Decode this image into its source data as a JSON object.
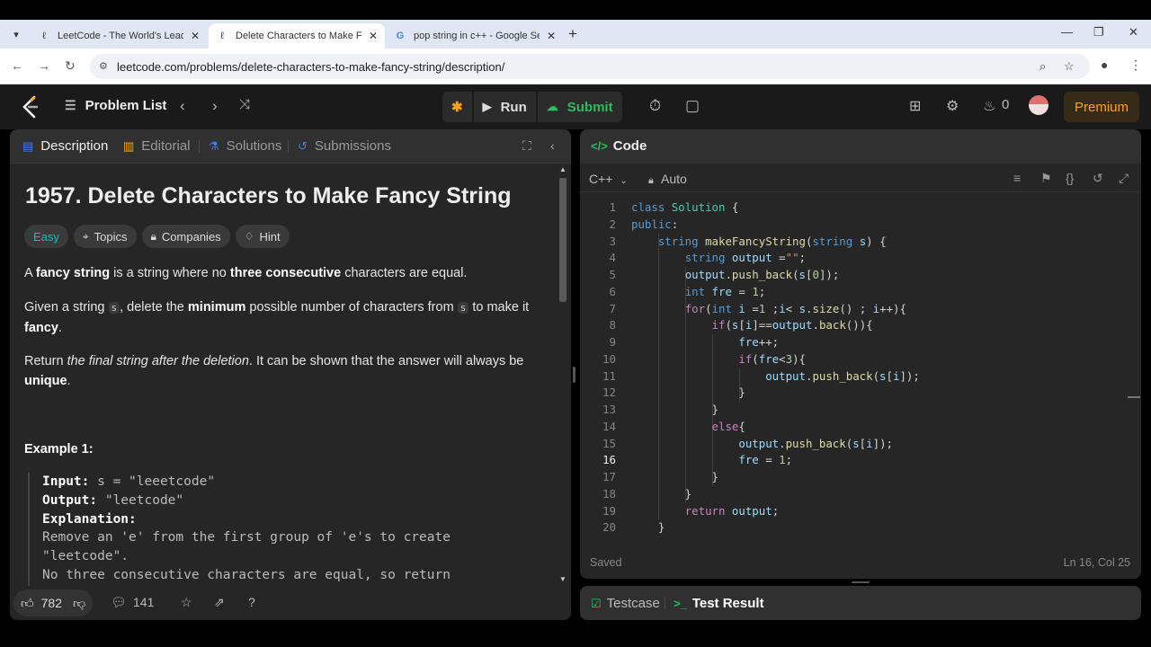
{
  "browser": {
    "tabs": [
      {
        "title": "LeetCode - The World's Leading",
        "active": false,
        "favicon": "leetcode-icon"
      },
      {
        "title": "Delete Characters to Make Fanc",
        "active": true,
        "favicon": "leetcode-icon"
      },
      {
        "title": "pop string in c++ - Google Sea",
        "active": false,
        "favicon": "google-icon"
      }
    ],
    "new_tab_symbol": "+",
    "url": "leetcode.com/problems/delete-characters-to-make-fancy-string/description/"
  },
  "header": {
    "problem_list_label": "Problem List",
    "run_label": "Run",
    "submit_label": "Submit",
    "streak_count": "0",
    "premium_label": "Premium"
  },
  "left": {
    "tabs": [
      "Description",
      "Editorial",
      "Solutions",
      "Submissions"
    ],
    "title": "1957. Delete Characters to Make Fancy String",
    "tags": [
      "Easy",
      "Topics",
      "Companies",
      "Hint"
    ],
    "p1": {
      "a": "A ",
      "b": "fancy string",
      "c": " is a string where no ",
      "d": "three consecutive",
      "e": " characters are equal."
    },
    "p2": {
      "a": "Given a string ",
      "code1": "s",
      "b": ", delete the ",
      "c": "minimum",
      "d": " possible number of characters from ",
      "code2": "s",
      "e": " to make it ",
      "f": "fancy",
      "g": "."
    },
    "p3": {
      "a": "Return ",
      "b": "the final string after the deletion",
      "c": ". It can be shown that the answer will always be ",
      "d": "unique",
      "e": "."
    },
    "example_heading": "Example 1:",
    "example": {
      "input_label": "Input:",
      "input_value": " s = \"leeetcode\"",
      "output_label": "Output:",
      "output_value": " \"leetcode\"",
      "explanation_label": "Explanation:",
      "line1": "Remove an 'e' from the first group of 'e's to create",
      "line2": "\"leetcode\".",
      "line3": "No three consecutive characters are equal, so return"
    },
    "likes": "782",
    "comments": "141"
  },
  "right": {
    "title": "Code",
    "language": "C++",
    "mode": "Auto",
    "status": "Saved",
    "cursor": "Ln 16, Col 25",
    "current_line": 16,
    "code_lines": [
      "class Solution {",
      "public:",
      "    string makeFancyString(string s) {",
      "        string output =\"\";",
      "        output.push_back(s[0]);",
      "        int fre = 1;",
      "        for(int i =1 ;i< s.size() ; i++){",
      "            if(s[i]==output.back()){",
      "                fre++;",
      "                if(fre<3){",
      "                    output.push_back(s[i]);",
      "                }",
      "            }",
      "            else{",
      "                output.push_back(s[i]);",
      "                fre = 1;",
      "            }",
      "        }",
      "        return output;",
      "    }"
    ]
  },
  "bottom": {
    "tabs": [
      "Testcase",
      "Test Result"
    ]
  }
}
